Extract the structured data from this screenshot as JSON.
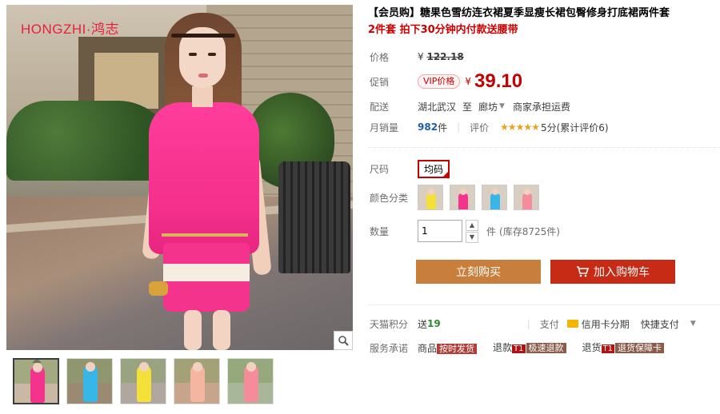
{
  "gallery": {
    "brand": "HONGZHI·鸿志",
    "thumbnails": [
      {
        "dress": "#f4338d",
        "bg": "#c8b8a4"
      },
      {
        "dress": "#38b6e8",
        "bg": "#9a8a74"
      },
      {
        "dress": "#f5e03a",
        "bg": "#b0a8a0"
      },
      {
        "dress": "#f6b5a0",
        "bg": "#c7a48c"
      },
      {
        "dress": "#f58c9c",
        "bg": "#a8b69a"
      }
    ]
  },
  "product": {
    "title": "【会员购】糖果色雪纺连衣裙夏季显瘦长裙包臀修身打底裙两件套",
    "subtitle": "2件套 拍下30分钟内付款送腰带"
  },
  "price_row": {
    "label": "价格",
    "currency": "¥",
    "value": "122.18"
  },
  "promo_row": {
    "label": "促销",
    "badge": "VIP价格",
    "currency": "¥",
    "value": "39.10"
  },
  "shipping_row": {
    "label": "配送",
    "origin": "湖北武汉",
    "to": "至",
    "destination": "廊坊",
    "note": "商家承担运费"
  },
  "sales_row": {
    "label": "月销量",
    "count": "982",
    "unit": "件",
    "review_label": "评价",
    "stars": "★★★★★",
    "score": "5分(累计评价6)"
  },
  "size_row": {
    "label": "尺码",
    "option": "均码"
  },
  "color_row": {
    "label": "颜色分类",
    "swatches": [
      {
        "dress": "#f5e03a"
      },
      {
        "dress": "#f4338d"
      },
      {
        "dress": "#38b6e8"
      },
      {
        "dress": "#f58c9c"
      }
    ]
  },
  "qty_row": {
    "label": "数量",
    "value": "1",
    "up": "▲",
    "down": "▼",
    "unit": "件",
    "stock": "(库存8725件)"
  },
  "actions": {
    "buy": "立刻购买",
    "cart": "加入购物车"
  },
  "points_row": {
    "label": "天猫积分",
    "prefix": "送",
    "points": "19",
    "pay_label": "支付",
    "credit": "信用卡分期",
    "quick": "快捷支付"
  },
  "service_row": {
    "label": "服务承诺",
    "items": [
      {
        "prefix": "商品",
        "tag_t1": "",
        "tag": "按时发货"
      },
      {
        "prefix": "退款",
        "tag_t1": "T1",
        "tag": "极速退款"
      },
      {
        "prefix": "退货",
        "tag_t1": "T1",
        "tag": "退货保障卡"
      }
    ]
  },
  "colors": {
    "price_red": "#c40000",
    "buy_orange": "#c87f3b",
    "cart_red": "#c72a15",
    "dress_pink": "#f4338d"
  }
}
